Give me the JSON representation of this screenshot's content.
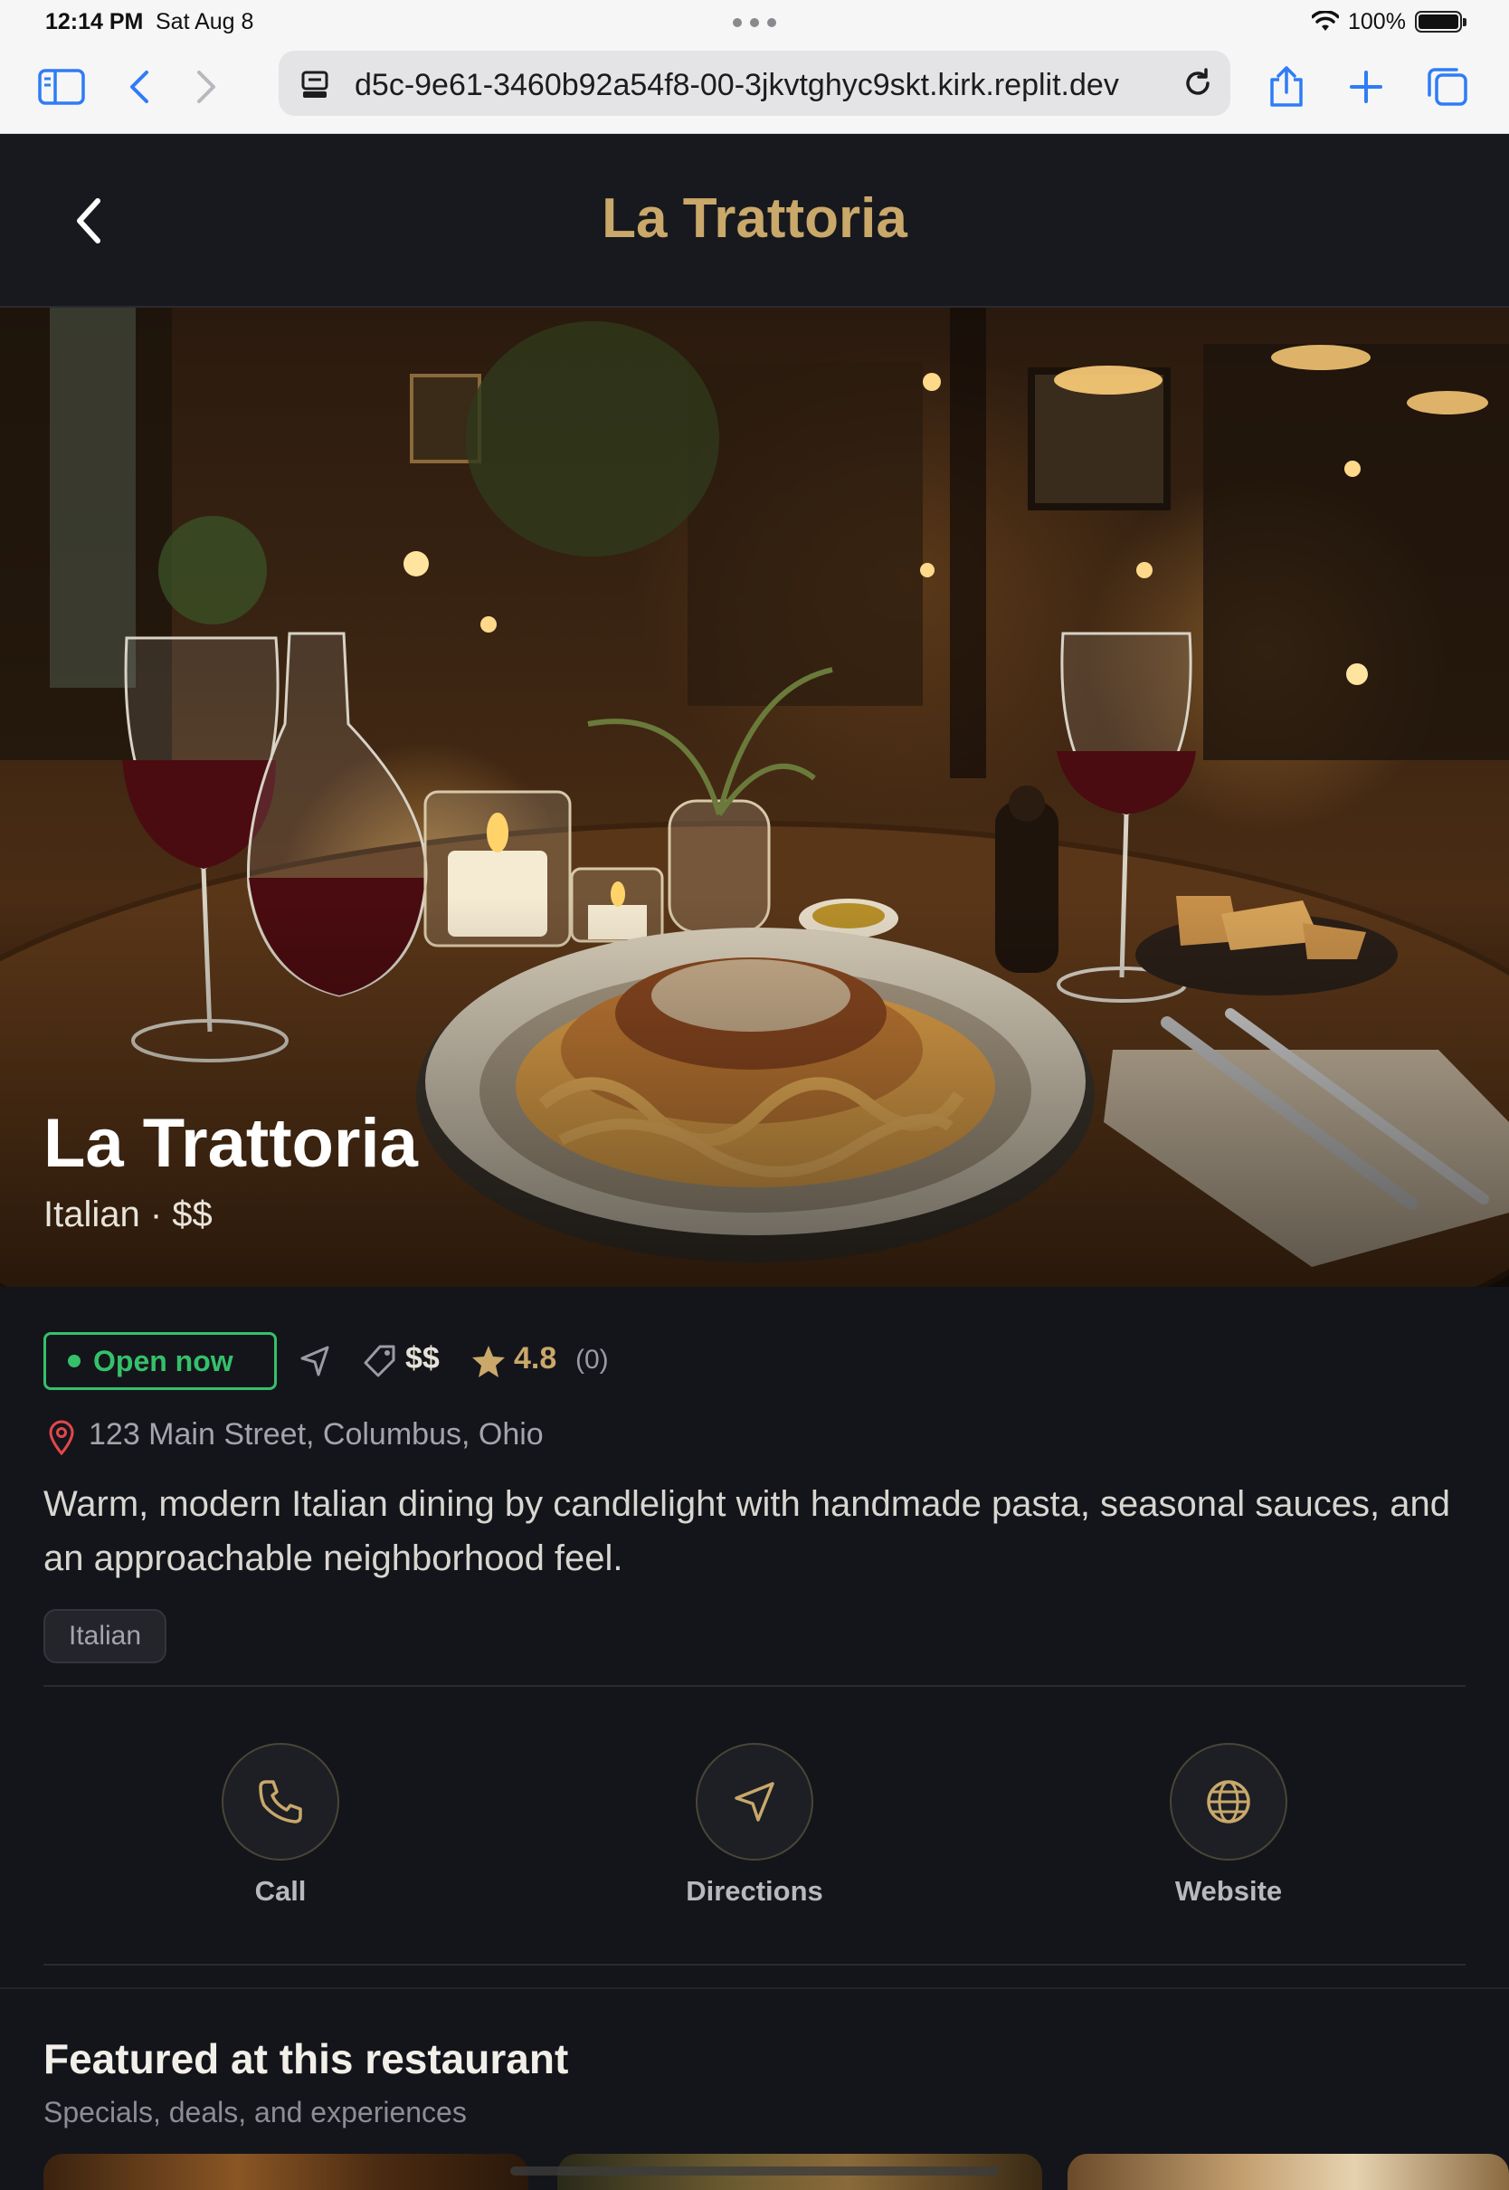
{
  "status_bar": {
    "time": "12:14 PM",
    "date": "Sat Aug 8",
    "battery": "100%"
  },
  "browser": {
    "url": "d5c-9e61-3460b92a54f8-00-3jkvtghyc9skt.kirk.replit.dev"
  },
  "header": {
    "title": "La Trattoria"
  },
  "hero": {
    "name": "La Trattoria",
    "subtitle": "Italian · $$"
  },
  "info": {
    "status": "Open now",
    "price": "$$",
    "rating": "4.8",
    "review_count": "(0)",
    "address": "123 Main Street, Columbus, Ohio",
    "description": "Warm, modern Italian dining by candlelight with handmade pasta, seasonal sauces, and an approachable neighborhood feel.",
    "tags": [
      "Italian"
    ]
  },
  "actions": [
    {
      "label": "Call",
      "icon": "phone-icon"
    },
    {
      "label": "Directions",
      "icon": "navigation-arrow-icon"
    },
    {
      "label": "Website",
      "icon": "globe-icon"
    }
  ],
  "featured": {
    "title": "Featured at this restaurant",
    "subtitle": "Specials, deals, and experiences"
  },
  "colors": {
    "accent_gold": "#c9a86a",
    "open_green": "#35c06a",
    "background": "#14151a",
    "link_blue": "#2f7cf6"
  }
}
